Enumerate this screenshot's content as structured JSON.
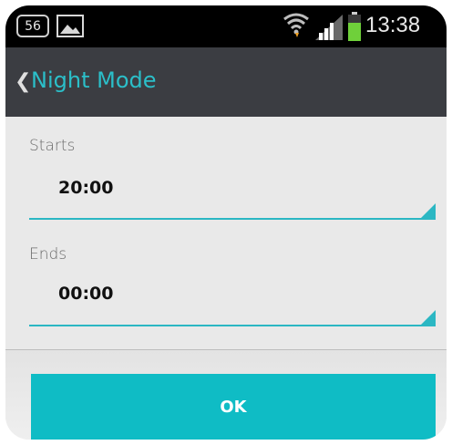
{
  "status_bar": {
    "notification_count": "56",
    "time": "13:38",
    "icons": [
      "notification-badge",
      "image-icon",
      "wifi-icon",
      "signal-icon",
      "battery-icon"
    ]
  },
  "action_bar": {
    "back_glyph": "❮",
    "title": "Night Mode"
  },
  "form": {
    "starts_label": "Starts",
    "starts_value": "20:00",
    "ends_label": "Ends",
    "ends_value": "00:00"
  },
  "ok_button": {
    "label": "OK"
  },
  "colors": {
    "accent": "#2bbfc9",
    "button": "#0fbcc5",
    "action_bar": "#3b3d42",
    "background": "#e9e9e9"
  }
}
